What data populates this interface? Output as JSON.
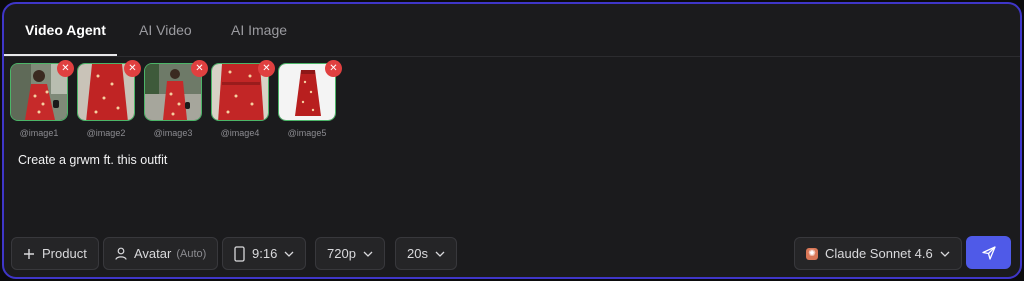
{
  "tabs": [
    {
      "label": "Video Agent",
      "active": true
    },
    {
      "label": "AI Video",
      "active": false
    },
    {
      "label": "AI Image",
      "active": false
    }
  ],
  "images": [
    {
      "caption": "@image1"
    },
    {
      "caption": "@image2"
    },
    {
      "caption": "@image3"
    },
    {
      "caption": "@image4"
    },
    {
      "caption": "@image5"
    }
  ],
  "prompt": "Create a grwm ft. this outfit",
  "toolbar": {
    "product_label": "Product",
    "avatar_label": "Avatar",
    "avatar_mode": "(Auto)",
    "aspect_label": "9:16",
    "resolution_label": "720p",
    "duration_label": "20s",
    "model_label": "Claude Sonnet 4.6"
  },
  "colors": {
    "accent": "#4f5ae8",
    "border": "#3f36c8",
    "remove": "#e04040",
    "thumb_border": "#4cb568"
  },
  "icons": [
    "plus-icon",
    "user-icon",
    "phone-portrait-icon",
    "chevron-down-icon",
    "send-icon",
    "close-icon",
    "claude-logo-icon"
  ]
}
